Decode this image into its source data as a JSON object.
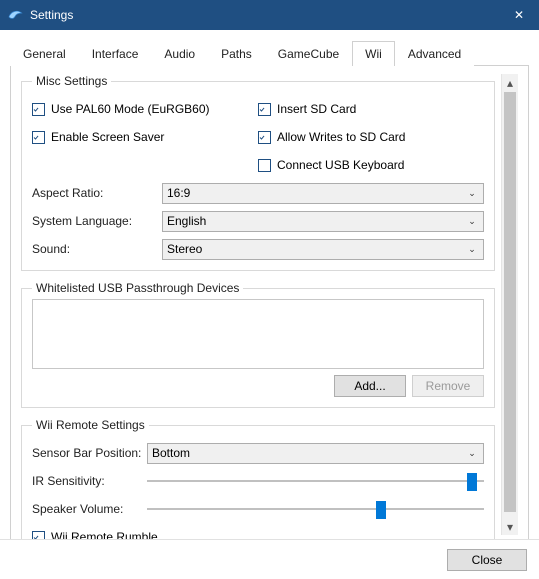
{
  "window": {
    "title": "Settings",
    "close_glyph": "✕"
  },
  "tabs": [
    {
      "label": "General"
    },
    {
      "label": "Interface"
    },
    {
      "label": "Audio"
    },
    {
      "label": "Paths"
    },
    {
      "label": "GameCube"
    },
    {
      "label": "Wii"
    },
    {
      "label": "Advanced"
    }
  ],
  "active_tab": "Wii",
  "misc": {
    "legend": "Misc Settings",
    "pal60": {
      "label": "Use PAL60 Mode (EuRGB60)",
      "checked": true
    },
    "sd_insert": {
      "label": "Insert SD Card",
      "checked": true
    },
    "screensaver": {
      "label": "Enable Screen Saver",
      "checked": true
    },
    "sd_write": {
      "label": "Allow Writes to SD Card",
      "checked": true
    },
    "usb_kb": {
      "label": "Connect USB Keyboard",
      "checked": false
    },
    "aspect": {
      "label": "Aspect Ratio:",
      "value": "16:9"
    },
    "language": {
      "label": "System Language:",
      "value": "English"
    },
    "sound": {
      "label": "Sound:",
      "value": "Stereo"
    }
  },
  "usb": {
    "legend": "Whitelisted USB Passthrough Devices",
    "add_label": "Add...",
    "remove_label": "Remove",
    "remove_enabled": false
  },
  "remote": {
    "legend": "Wii Remote Settings",
    "sensor_label": "Sensor Bar Position:",
    "sensor_value": "Bottom",
    "ir_label": "IR Sensitivity:",
    "ir_value": 98,
    "speaker_label": "Speaker Volume:",
    "speaker_value": 70,
    "rumble": {
      "label": "Wii Remote Rumble",
      "checked": true
    }
  },
  "footer": {
    "close_label": "Close"
  },
  "glyphs": {
    "dropdown": "⌄",
    "scroll_up": "▴",
    "scroll_down": "▾"
  }
}
